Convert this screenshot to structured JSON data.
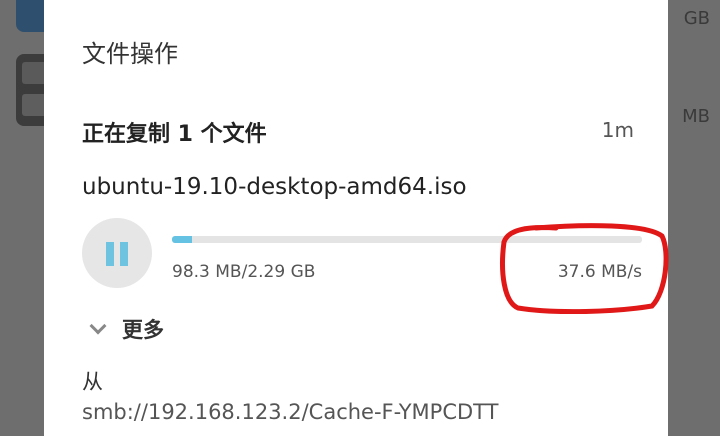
{
  "background": {
    "list_item_sizes": [
      "GB",
      "MB"
    ]
  },
  "dialog": {
    "title": "文件操作",
    "status": "正在复制 1 个文件",
    "elapsed": "1m",
    "file_name": "ubuntu-19.10-desktop-amd64.iso",
    "transferred": "98.3 MB/2.29 GB",
    "speed": "37.6 MB/s",
    "progress_fraction": 0.043,
    "pause_icon": "pause-icon",
    "more_label": "更多",
    "from_label": "从",
    "from_path": "smb://192.168.123.2/Cache-F-YMPCDTT"
  },
  "colors": {
    "progress_fill": "#66c2e2",
    "pause_bars": "#6ec4e0",
    "annotation_circle": "#e01818"
  }
}
